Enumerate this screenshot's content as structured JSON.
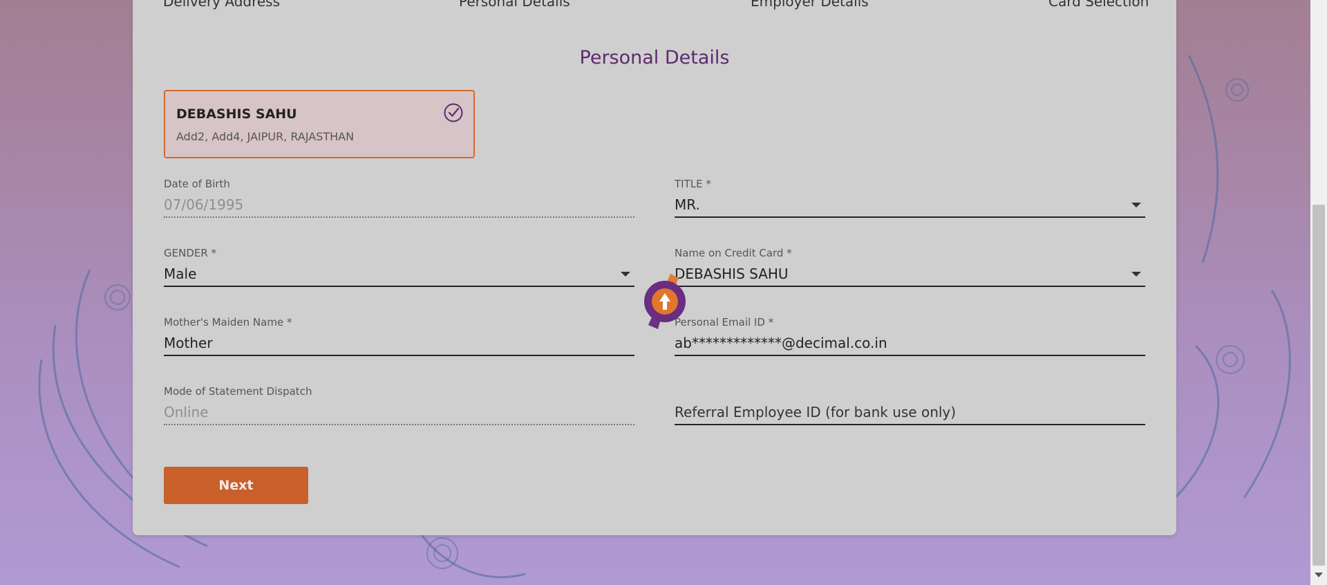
{
  "steps": [
    "Delivery Address",
    "Personal Details",
    "Employer Details",
    "Card Selection"
  ],
  "section_title": "Personal Details",
  "address_card": {
    "name": "DEBASHIS SAHU",
    "address": "Add2, Add4, JAIPUR, RAJASTHAN"
  },
  "fields": {
    "dob": {
      "label": "Date of Birth",
      "value": "07/06/1995"
    },
    "title": {
      "label": "TITLE *",
      "value": "MR."
    },
    "gender": {
      "label": "GENDER *",
      "value": "Male"
    },
    "name_on_card": {
      "label": "Name on Credit Card *",
      "value": "DEBASHIS SAHU"
    },
    "mothers_maiden": {
      "label": "Mother's Maiden Name *",
      "value": "Mother"
    },
    "email": {
      "label": "Personal Email ID *",
      "value": "ab*************@decimal.co.in"
    },
    "statement_mode": {
      "label": "Mode of Statement Dispatch",
      "value": "Online"
    },
    "referral": {
      "placeholder": "Referral Employee ID (for bank use only)"
    }
  },
  "next_label": "Next",
  "colors": {
    "accent": "#c95f2b",
    "title": "#5c2a6e",
    "card": "#cfcfcf",
    "address_border": "#d2692f"
  }
}
